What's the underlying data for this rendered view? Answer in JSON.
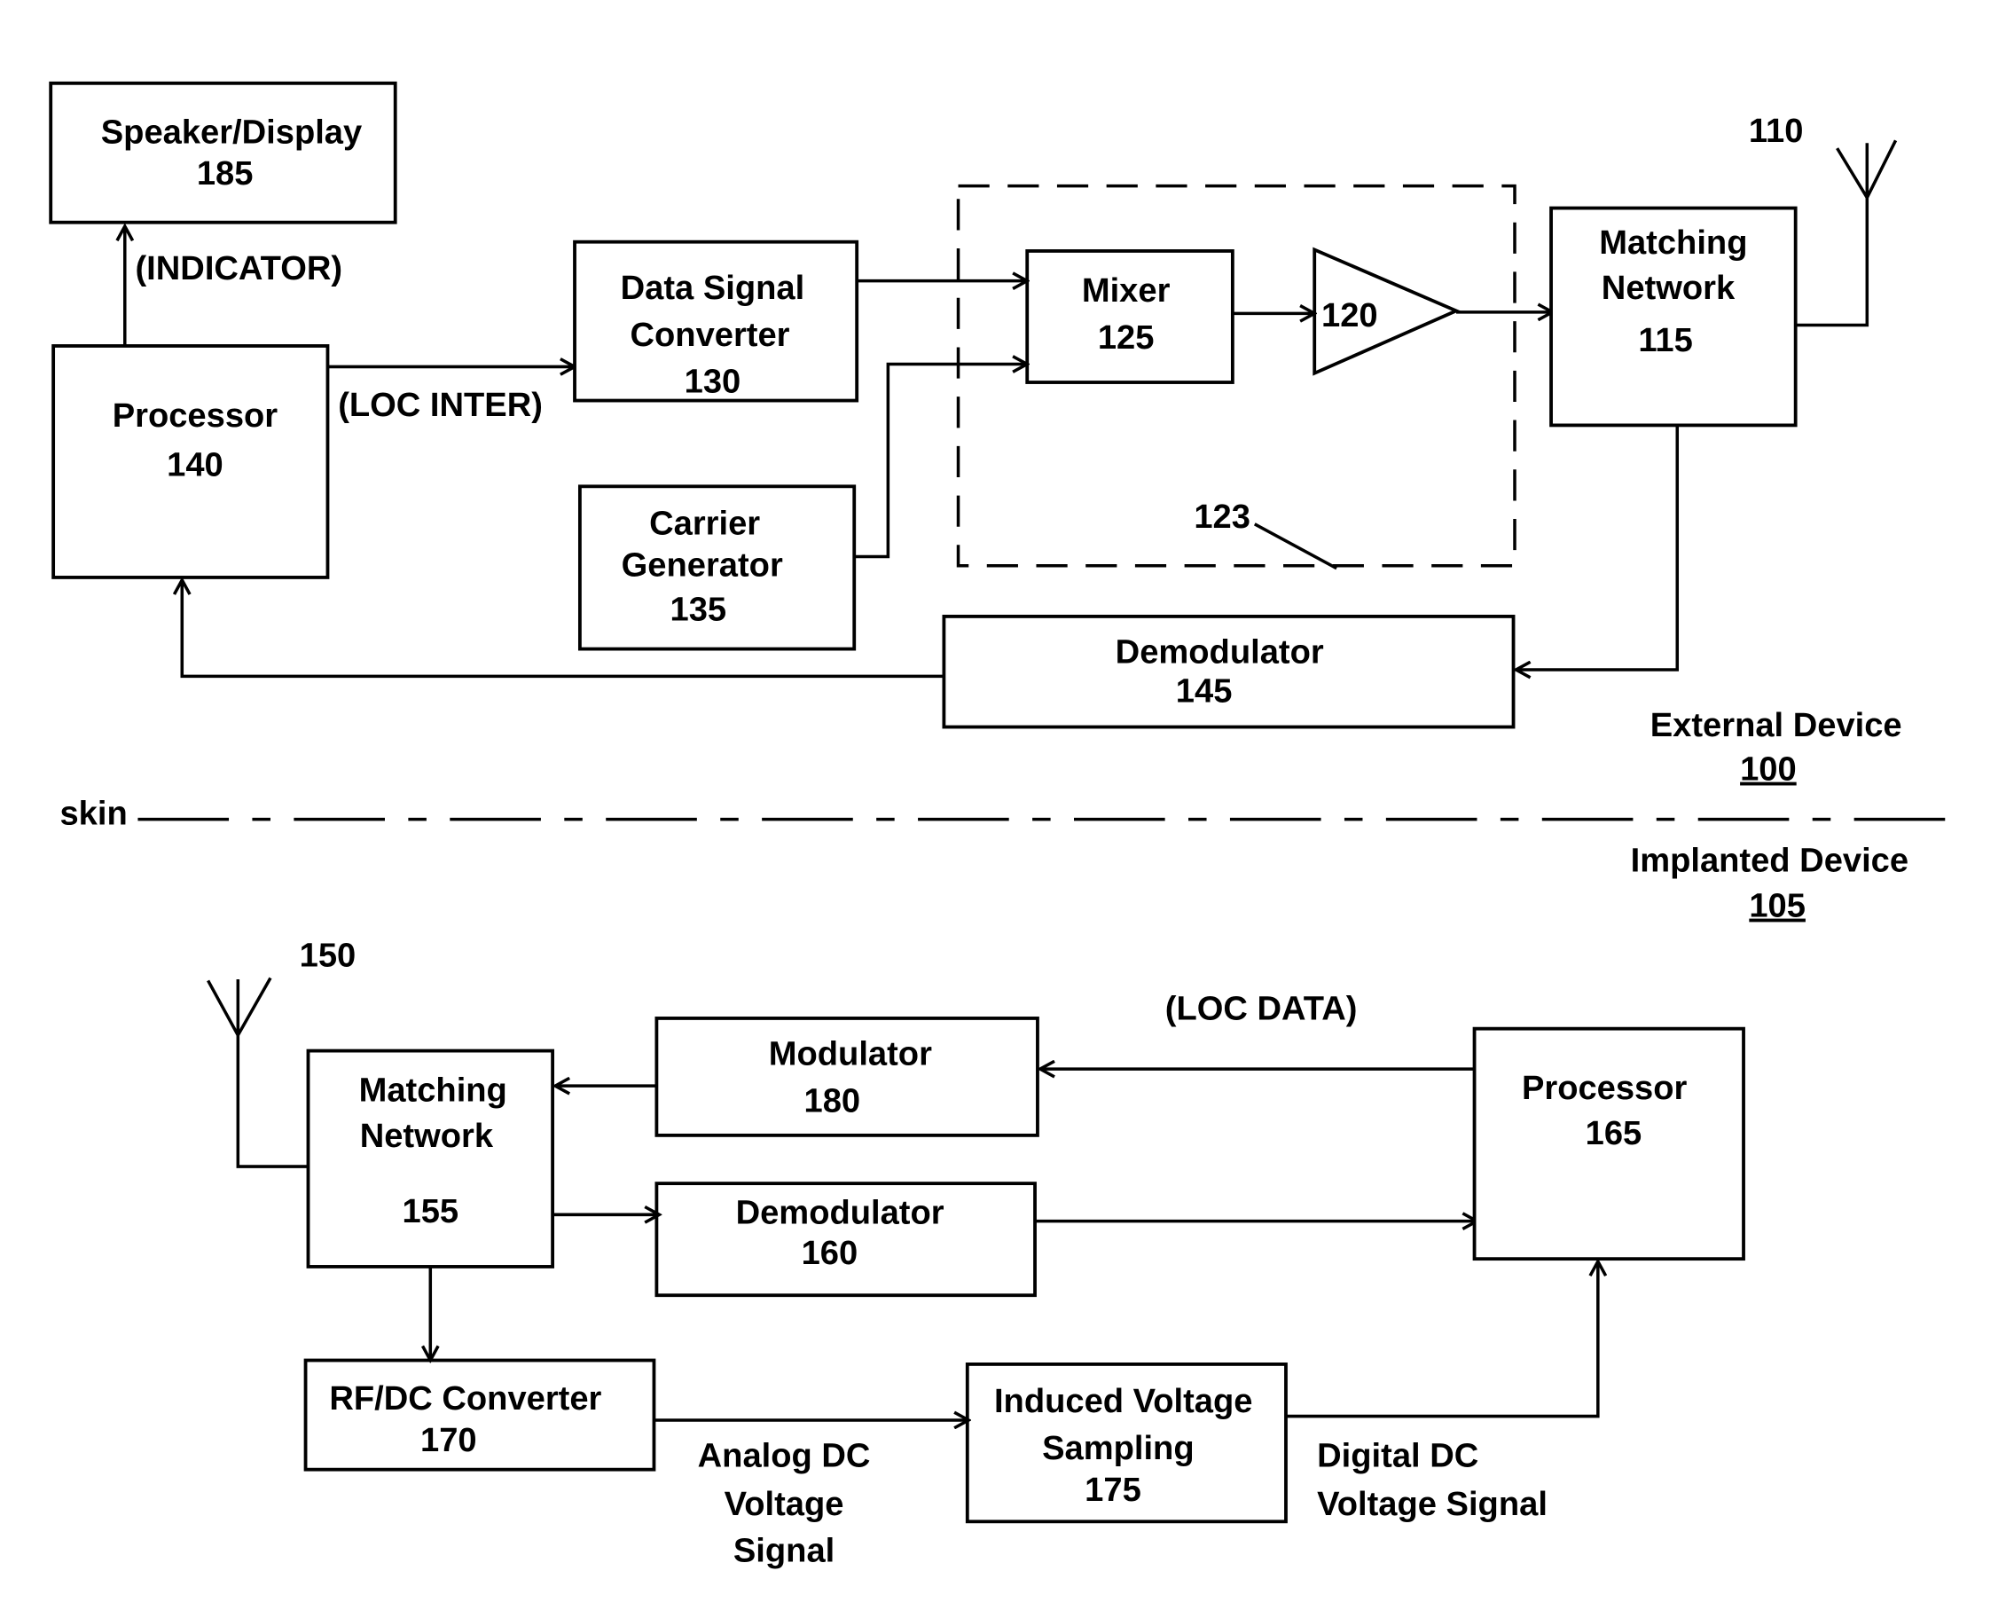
{
  "figure": {
    "external_device": {
      "label": "External Device",
      "ref": "100"
    },
    "implanted_device": {
      "label": "Implanted Device",
      "ref": "105"
    },
    "skin_label": "skin",
    "blocks": {
      "speaker_display": {
        "name": "Speaker/Display",
        "ref": "185"
      },
      "processor_140": {
        "name": "Processor",
        "ref": "140"
      },
      "data_signal_converter": {
        "line1": "Data Signal",
        "line2": "Converter",
        "ref": "130"
      },
      "carrier_generator": {
        "line1": "Carrier",
        "line2": "Generator",
        "ref": "135"
      },
      "mixer": {
        "name": "Mixer",
        "ref": "125"
      },
      "amplifier": {
        "ref": "120"
      },
      "transmitter_group": {
        "ref": "123"
      },
      "matching_network_115": {
        "line1": "Matching",
        "line2": "Network",
        "ref": "115"
      },
      "antenna_110": {
        "ref": "110"
      },
      "demodulator_145": {
        "name": "Demodulator",
        "ref": "145"
      },
      "antenna_150": {
        "ref": "150"
      },
      "matching_network_155": {
        "line1": "Matching",
        "line2": "Network",
        "ref": "155"
      },
      "modulator_180": {
        "name": "Modulator",
        "ref": "180"
      },
      "demodulator_160": {
        "name": "Demodulator",
        "ref": "160"
      },
      "processor_165": {
        "name": "Processor",
        "ref": "165"
      },
      "rf_dc_converter": {
        "name": "RF/DC Converter",
        "ref": "170"
      },
      "induced_voltage_sampling": {
        "line1": "Induced Voltage",
        "line2": "Sampling",
        "ref": "175"
      }
    },
    "signals": {
      "indicator": "(INDICATOR)",
      "loc_inter": "(LOC INTER)",
      "loc_data": "(LOC DATA)",
      "analog_dc": [
        "Analog DC",
        "Voltage",
        "Signal"
      ],
      "digital_dc": [
        "Digital DC",
        "Voltage Signal"
      ]
    }
  }
}
